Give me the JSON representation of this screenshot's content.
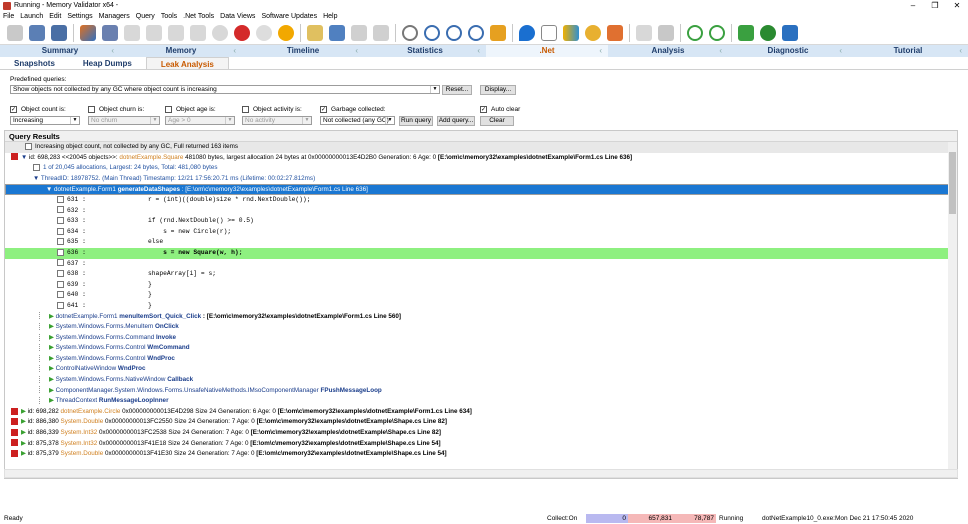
{
  "window": {
    "title": "Running - Memory Validator x64 -",
    "controls": [
      "–",
      "❐",
      "✕"
    ]
  },
  "menu": [
    "File",
    "Launch",
    "Edit",
    "Settings",
    "Managers",
    "Query",
    "Tools",
    ".Net Tools",
    "Data Views",
    "Software Updates",
    "Help"
  ],
  "main_tabs": [
    "Summary",
    "Memory",
    "Timeline",
    "Statistics",
    ".Net",
    "Analysis",
    "Diagnostic",
    "Tutorial"
  ],
  "active_main_tab": ".Net",
  "sub_tabs": [
    "Snapshots",
    "Heap Dumps",
    "Leak Analysis"
  ],
  "active_sub_tab": "Leak Analysis",
  "predefined": {
    "label": "Predefined queries:",
    "value": "Show objects not collected by any GC where object count is increasing",
    "reset_label": "Reset...",
    "display_label": "Display..."
  },
  "filters": {
    "object_count": {
      "label": "Object count is:",
      "checked": "✓",
      "value": "Increasing"
    },
    "object_churn": {
      "label": "Object churn is:",
      "checked": "",
      "value": "No churn"
    },
    "object_age": {
      "label": "Object age is:",
      "checked": "",
      "value": "Age > 0"
    },
    "object_activity": {
      "label": "Object activity is:",
      "checked": "",
      "value": "No activity"
    },
    "garbage": {
      "label": "Garbage collected:",
      "checked": "✓",
      "value": "Not collected (any GC)"
    },
    "auto_clear": {
      "label": "Auto clear",
      "checked": "✓"
    }
  },
  "buttons": {
    "run_query": "Run query",
    "add_query": "Add query...",
    "clear": "Clear"
  },
  "results": {
    "title": "Query Results",
    "summary": "Increasing object count, not collected by any GC, Full returned 163 items",
    "rows": [
      {
        "type": "top",
        "parts": [
          "id: 698,283 <<20045 objects>>: ",
          "dotnetExample.Square",
          " 481080 bytes, largest allocation 24 bytes at 0x00000000013E4D2B0 Generation: 6 Age: 0 ",
          "[E:\\om\\c\\memory32\\examples\\dotnetExample\\Form1.cs Line 636]"
        ]
      },
      {
        "type": "child",
        "text": "1 of 20,045 allocations, Largest: 24 bytes, Total: 481,080 bytes"
      },
      {
        "type": "thread",
        "text": "ThreadID: 18978752. (Main Thread) Timestamp: 12/21 17:56:20.71 ms (Lifetime: 00:02:27.812ms)"
      },
      {
        "type": "selected",
        "parts": [
          "dotnetExample.Form1 ",
          "generateDataShapes",
          " : [E:\\om\\c\\memory32\\examples\\dotnetExample\\Form1.cs Line 636]"
        ]
      },
      {
        "type": "code",
        "line": "631",
        "code": "r = (int)((double)size * rnd.NextDouble());"
      },
      {
        "type": "code",
        "line": "632",
        "code": ""
      },
      {
        "type": "code",
        "line": "633",
        "code": "if (rnd.NextDouble() >= 0.5)"
      },
      {
        "type": "code",
        "line": "634",
        "code": "    s = new Circle(r);"
      },
      {
        "type": "code",
        "line": "635",
        "code": "else"
      },
      {
        "type": "codehl",
        "line": "636",
        "code": "    s = new Square(w, h);"
      },
      {
        "type": "code",
        "line": "637",
        "code": ""
      },
      {
        "type": "code",
        "line": "638",
        "code": "shapeArray[i] = s;"
      },
      {
        "type": "code",
        "line": "639",
        "code": "}"
      },
      {
        "type": "code",
        "line": "640",
        "code": "}"
      },
      {
        "type": "code",
        "line": "641",
        "code": "}"
      },
      {
        "type": "frame",
        "parts": [
          "dotnetExample.Form1 ",
          "menuItemSort_Quick_Click",
          " : [E:\\om\\c\\memory32\\examples\\dotnetExample\\Form1.cs Line 560]"
        ]
      },
      {
        "type": "frame",
        "parts": [
          "System.Windows.Forms.MenuItem ",
          "OnClick",
          ""
        ]
      },
      {
        "type": "frame",
        "parts": [
          "System.Windows.Forms.Command ",
          "Invoke",
          ""
        ]
      },
      {
        "type": "frame",
        "parts": [
          "System.Windows.Forms.Control ",
          "WmCommand",
          ""
        ]
      },
      {
        "type": "frame",
        "parts": [
          "System.Windows.Forms.Control ",
          "WndProc",
          ""
        ]
      },
      {
        "type": "frame",
        "parts": [
          "ControlNativeWindow ",
          "WndProc",
          ""
        ]
      },
      {
        "type": "frame",
        "parts": [
          "System.Windows.Forms.NativeWindow ",
          "Callback",
          ""
        ]
      },
      {
        "type": "frame",
        "parts": [
          "ComponentManager.System.Windows.Forms.UnsafeNativeMethods.IMsoComponentManager ",
          "FPushMessageLoop",
          ""
        ]
      },
      {
        "type": "frame",
        "parts": [
          "ThreadContext ",
          "RunMessageLoopInner",
          ""
        ]
      },
      {
        "type": "top",
        "parts": [
          "id: 698,282 ",
          "dotnetExample.Circle",
          " 0x000000000013E4D298 Size 24 Generation: 6 Age: 0 ",
          "[E:\\om\\c\\memory32\\examples\\dotnetExample\\Form1.cs Line 634]"
        ]
      },
      {
        "type": "top",
        "parts": [
          "id: 886,380 ",
          "System.Double",
          " 0x00000000013FC2550 Size 24 Generation: 7 Age: 0 ",
          "[E:\\om\\c\\memory32\\examples\\dotnetExample\\Shape.cs Line 82]"
        ]
      },
      {
        "type": "top",
        "parts": [
          "id: 886,339 ",
          "System.Int32",
          " 0x00000000013FC2538 Size 24 Generation: 7 Age: 0 ",
          "[E:\\om\\c\\memory32\\examples\\dotnetExample\\Shape.cs Line 82]"
        ]
      },
      {
        "type": "top",
        "parts": [
          "id: 875,378 ",
          "System.Int32",
          " 0x00000000013F41E18 Size 24 Generation: 7 Age: 0 ",
          "[E:\\om\\c\\memory32\\examples\\dotnetExample\\Shape.cs Line 54]"
        ]
      },
      {
        "type": "top",
        "parts": [
          "id: 875,379 ",
          "System.Double",
          " 0x00000000013F41E30 Size 24 Generation: 7 Age: 0 ",
          "[E:\\om\\c\\memory32\\examples\\dotnetExample\\Shape.cs Line 54]"
        ]
      }
    ]
  },
  "status": {
    "left": "Ready",
    "collect": "Collect:On",
    "val_zero": "0",
    "val_a": "657,831",
    "val_b": "78,787",
    "running": "Running",
    "exe": "dotNetExample10_0.exe:Mon Dec 21 17:50:45 2020"
  },
  "colors": {
    "accent": "#1a77d2",
    "highlight": "#8ef080",
    "tab_bg": "#d7e6f5",
    "active_tab_text": "#c85a00"
  }
}
